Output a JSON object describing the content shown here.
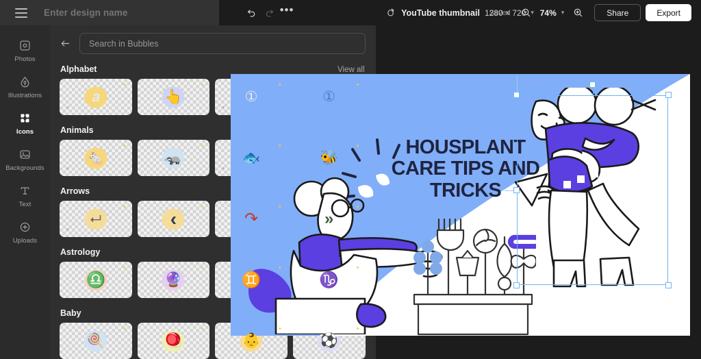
{
  "header": {
    "menu_icon": "hamburger-icon",
    "design_name_placeholder": "Enter design name",
    "design_name_value": ""
  },
  "toolbar": {
    "undo_icon": "undo-arrow-icon",
    "redo_icon": "redo-arrow-icon",
    "more_label": "•••",
    "resize_icon": "resize-rotate-icon",
    "doc_title": "YouTube thumbnail",
    "doc_dimensions": "1280 × 720",
    "doc_chevron": "▾",
    "saved_label": "Saved",
    "zoom_out_icon": "zoom-out-icon",
    "zoom_level": "74%",
    "zoom_chevron": "▾",
    "zoom_in_icon": "zoom-in-icon",
    "share_label": "Share",
    "export_label": "Export"
  },
  "rail": {
    "items": [
      {
        "label": "Photos",
        "icon": "photo-frame-icon",
        "active": false
      },
      {
        "label": "Illustrations",
        "icon": "pen-nib-icon",
        "active": false
      },
      {
        "label": "Icons",
        "icon": "icons-grid-icon",
        "active": true
      },
      {
        "label": "Backgrounds",
        "icon": "image-icon",
        "active": false
      },
      {
        "label": "Text",
        "icon": "text-t-icon",
        "active": false
      },
      {
        "label": "Uploads",
        "icon": "plus-circle-icon",
        "active": false
      }
    ]
  },
  "panel": {
    "back_icon": "back-arrow-icon",
    "search_placeholder": "Search in Bubbles",
    "search_value": "",
    "view_all_label": "View all",
    "categories": [
      {
        "title": "Alphabet",
        "items": [
          {
            "name": "letter-a-icon",
            "glyph": "𝒂",
            "halo": "#f6d77a"
          },
          {
            "name": "hand-point-up-icon",
            "glyph": "👆",
            "halo": "#cfd4f5"
          },
          {
            "name": "number-one-coin-icon",
            "glyph": "①",
            "halo": "#f6d35a"
          },
          {
            "name": "number-one-badge-icon",
            "glyph": "①",
            "halo": "#f6cfc6"
          }
        ]
      },
      {
        "title": "Animals",
        "items": [
          {
            "name": "mouse-icon",
            "glyph": "🐁",
            "halo": "#f6d77a"
          },
          {
            "name": "red-panda-icon",
            "glyph": "🦡",
            "halo": "#cfe3f2"
          },
          {
            "name": "fish-icon",
            "glyph": "🐟",
            "halo": "#f6cfc6"
          },
          {
            "name": "bee-hive-icon",
            "glyph": "🐝",
            "halo": "#f6cfc6"
          }
        ]
      },
      {
        "title": "Arrows",
        "items": [
          {
            "name": "curved-arrow-icon",
            "glyph": "⮠",
            "halo": "#f6dc9a"
          },
          {
            "name": "chevron-left-icon",
            "glyph": "‹",
            "halo": "#f6dc9a"
          },
          {
            "name": "redo-curve-arrow-icon",
            "glyph": "↷",
            "halo": "#cfe3f2"
          },
          {
            "name": "double-chevron-right-icon",
            "glyph": "»",
            "halo": "#f6dc9a"
          }
        ]
      },
      {
        "title": "Astrology",
        "items": [
          {
            "name": "libra-icon",
            "glyph": "♎",
            "halo": "#f6cfc6"
          },
          {
            "name": "fortune-teller-icon",
            "glyph": "🔮",
            "halo": "#e6d0f0"
          },
          {
            "name": "gemini-icon",
            "glyph": "♊",
            "halo": "#f6cfc6"
          },
          {
            "name": "capricorn-icon",
            "glyph": "♑",
            "halo": "#e8f0a8"
          }
        ]
      },
      {
        "title": "Baby",
        "items": [
          {
            "name": "pacifier-icon",
            "glyph": "🍭",
            "halo": "#cfe3f2"
          },
          {
            "name": "rattle-icon",
            "glyph": "🪀",
            "halo": "#eef0b0"
          },
          {
            "name": "baby-icon",
            "glyph": "👶",
            "halo": "#f6dc9a"
          },
          {
            "name": "baby-ball-icon",
            "glyph": "⚽",
            "halo": "#e0dcf5"
          }
        ]
      }
    ]
  },
  "canvas": {
    "background_color": "#1c1c1c",
    "artboard_bg": "#81aef8",
    "accent_purple": "#5b3fe0",
    "ink": "#1f2440",
    "headline_lines": [
      "HOUSPLANT",
      "CARE TIPS AND",
      "TRICKS"
    ],
    "headline_text": "HOUSPLANT CARE TIPS AND TRICKS",
    "selection": {
      "name": "selected-illustration",
      "handles": [
        "top-left",
        "top-middle",
        "top-right",
        "bottom-left",
        "bottom-right",
        "left-middle"
      ]
    }
  }
}
